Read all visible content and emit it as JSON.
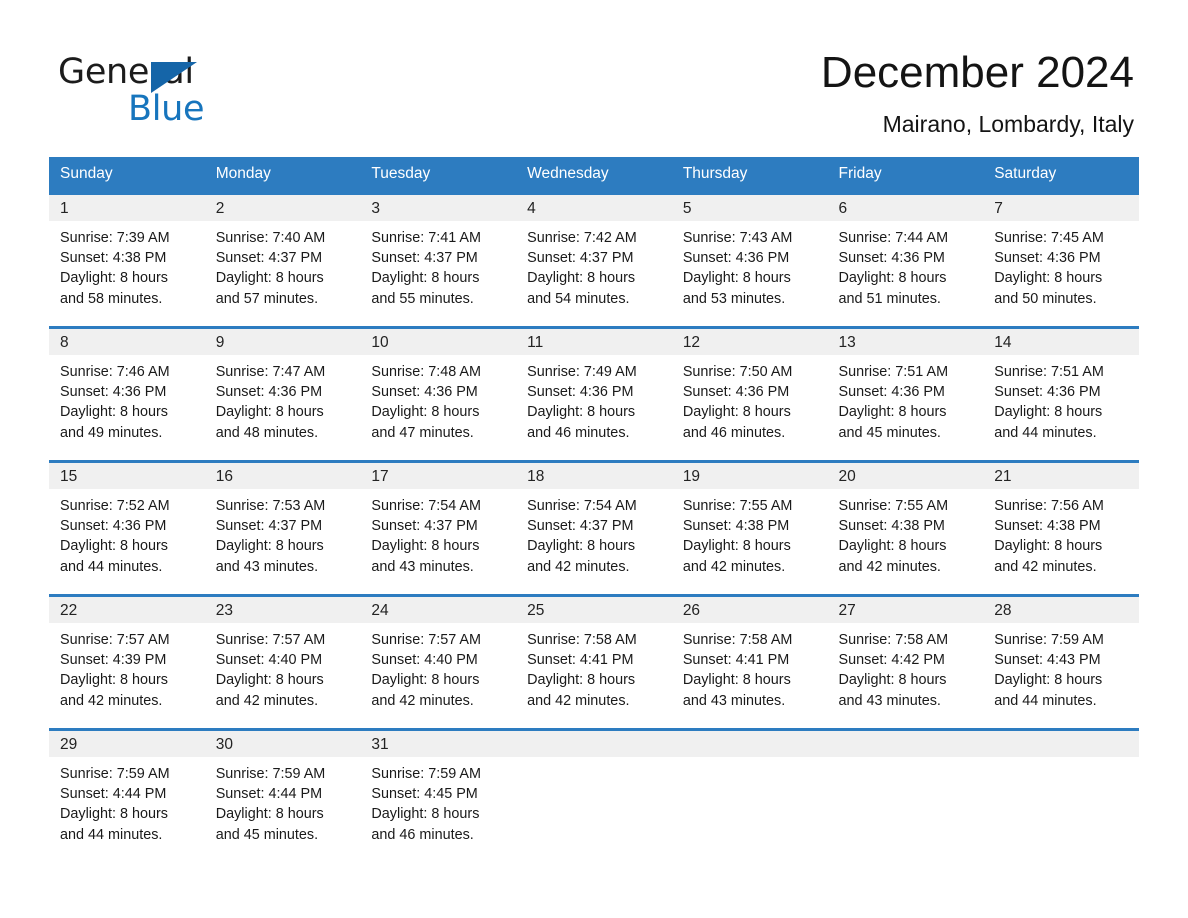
{
  "brand": {
    "word_one": "General",
    "word_two": "Blue",
    "triangle_color": "#1565a8",
    "blue_color": "#1775bd"
  },
  "header": {
    "title": "December 2024",
    "location": "Mairano, Lombardy, Italy"
  },
  "theme": {
    "header_row_bg": "#2d7cc0",
    "row_rule": "#2d7cc0",
    "daynum_band_bg": "#f0f0f0",
    "page_bg": "#ffffff",
    "text": "#1a1a1a"
  },
  "weekday_headers": [
    "Sunday",
    "Monday",
    "Tuesday",
    "Wednesday",
    "Thursday",
    "Friday",
    "Saturday"
  ],
  "weeks": [
    [
      {
        "day": "1",
        "sunrise": "Sunrise: 7:39 AM",
        "sunset": "Sunset: 4:38 PM",
        "daylight_1": "Daylight: 8 hours",
        "daylight_2": "and 58 minutes."
      },
      {
        "day": "2",
        "sunrise": "Sunrise: 7:40 AM",
        "sunset": "Sunset: 4:37 PM",
        "daylight_1": "Daylight: 8 hours",
        "daylight_2": "and 57 minutes."
      },
      {
        "day": "3",
        "sunrise": "Sunrise: 7:41 AM",
        "sunset": "Sunset: 4:37 PM",
        "daylight_1": "Daylight: 8 hours",
        "daylight_2": "and 55 minutes."
      },
      {
        "day": "4",
        "sunrise": "Sunrise: 7:42 AM",
        "sunset": "Sunset: 4:37 PM",
        "daylight_1": "Daylight: 8 hours",
        "daylight_2": "and 54 minutes."
      },
      {
        "day": "5",
        "sunrise": "Sunrise: 7:43 AM",
        "sunset": "Sunset: 4:36 PM",
        "daylight_1": "Daylight: 8 hours",
        "daylight_2": "and 53 minutes."
      },
      {
        "day": "6",
        "sunrise": "Sunrise: 7:44 AM",
        "sunset": "Sunset: 4:36 PM",
        "daylight_1": "Daylight: 8 hours",
        "daylight_2": "and 51 minutes."
      },
      {
        "day": "7",
        "sunrise": "Sunrise: 7:45 AM",
        "sunset": "Sunset: 4:36 PM",
        "daylight_1": "Daylight: 8 hours",
        "daylight_2": "and 50 minutes."
      }
    ],
    [
      {
        "day": "8",
        "sunrise": "Sunrise: 7:46 AM",
        "sunset": "Sunset: 4:36 PM",
        "daylight_1": "Daylight: 8 hours",
        "daylight_2": "and 49 minutes."
      },
      {
        "day": "9",
        "sunrise": "Sunrise: 7:47 AM",
        "sunset": "Sunset: 4:36 PM",
        "daylight_1": "Daylight: 8 hours",
        "daylight_2": "and 48 minutes."
      },
      {
        "day": "10",
        "sunrise": "Sunrise: 7:48 AM",
        "sunset": "Sunset: 4:36 PM",
        "daylight_1": "Daylight: 8 hours",
        "daylight_2": "and 47 minutes."
      },
      {
        "day": "11",
        "sunrise": "Sunrise: 7:49 AM",
        "sunset": "Sunset: 4:36 PM",
        "daylight_1": "Daylight: 8 hours",
        "daylight_2": "and 46 minutes."
      },
      {
        "day": "12",
        "sunrise": "Sunrise: 7:50 AM",
        "sunset": "Sunset: 4:36 PM",
        "daylight_1": "Daylight: 8 hours",
        "daylight_2": "and 46 minutes."
      },
      {
        "day": "13",
        "sunrise": "Sunrise: 7:51 AM",
        "sunset": "Sunset: 4:36 PM",
        "daylight_1": "Daylight: 8 hours",
        "daylight_2": "and 45 minutes."
      },
      {
        "day": "14",
        "sunrise": "Sunrise: 7:51 AM",
        "sunset": "Sunset: 4:36 PM",
        "daylight_1": "Daylight: 8 hours",
        "daylight_2": "and 44 minutes."
      }
    ],
    [
      {
        "day": "15",
        "sunrise": "Sunrise: 7:52 AM",
        "sunset": "Sunset: 4:36 PM",
        "daylight_1": "Daylight: 8 hours",
        "daylight_2": "and 44 minutes."
      },
      {
        "day": "16",
        "sunrise": "Sunrise: 7:53 AM",
        "sunset": "Sunset: 4:37 PM",
        "daylight_1": "Daylight: 8 hours",
        "daylight_2": "and 43 minutes."
      },
      {
        "day": "17",
        "sunrise": "Sunrise: 7:54 AM",
        "sunset": "Sunset: 4:37 PM",
        "daylight_1": "Daylight: 8 hours",
        "daylight_2": "and 43 minutes."
      },
      {
        "day": "18",
        "sunrise": "Sunrise: 7:54 AM",
        "sunset": "Sunset: 4:37 PM",
        "daylight_1": "Daylight: 8 hours",
        "daylight_2": "and 42 minutes."
      },
      {
        "day": "19",
        "sunrise": "Sunrise: 7:55 AM",
        "sunset": "Sunset: 4:38 PM",
        "daylight_1": "Daylight: 8 hours",
        "daylight_2": "and 42 minutes."
      },
      {
        "day": "20",
        "sunrise": "Sunrise: 7:55 AM",
        "sunset": "Sunset: 4:38 PM",
        "daylight_1": "Daylight: 8 hours",
        "daylight_2": "and 42 minutes."
      },
      {
        "day": "21",
        "sunrise": "Sunrise: 7:56 AM",
        "sunset": "Sunset: 4:38 PM",
        "daylight_1": "Daylight: 8 hours",
        "daylight_2": "and 42 minutes."
      }
    ],
    [
      {
        "day": "22",
        "sunrise": "Sunrise: 7:57 AM",
        "sunset": "Sunset: 4:39 PM",
        "daylight_1": "Daylight: 8 hours",
        "daylight_2": "and 42 minutes."
      },
      {
        "day": "23",
        "sunrise": "Sunrise: 7:57 AM",
        "sunset": "Sunset: 4:40 PM",
        "daylight_1": "Daylight: 8 hours",
        "daylight_2": "and 42 minutes."
      },
      {
        "day": "24",
        "sunrise": "Sunrise: 7:57 AM",
        "sunset": "Sunset: 4:40 PM",
        "daylight_1": "Daylight: 8 hours",
        "daylight_2": "and 42 minutes."
      },
      {
        "day": "25",
        "sunrise": "Sunrise: 7:58 AM",
        "sunset": "Sunset: 4:41 PM",
        "daylight_1": "Daylight: 8 hours",
        "daylight_2": "and 42 minutes."
      },
      {
        "day": "26",
        "sunrise": "Sunrise: 7:58 AM",
        "sunset": "Sunset: 4:41 PM",
        "daylight_1": "Daylight: 8 hours",
        "daylight_2": "and 43 minutes."
      },
      {
        "day": "27",
        "sunrise": "Sunrise: 7:58 AM",
        "sunset": "Sunset: 4:42 PM",
        "daylight_1": "Daylight: 8 hours",
        "daylight_2": "and 43 minutes."
      },
      {
        "day": "28",
        "sunrise": "Sunrise: 7:59 AM",
        "sunset": "Sunset: 4:43 PM",
        "daylight_1": "Daylight: 8 hours",
        "daylight_2": "and 44 minutes."
      }
    ],
    [
      {
        "day": "29",
        "sunrise": "Sunrise: 7:59 AM",
        "sunset": "Sunset: 4:44 PM",
        "daylight_1": "Daylight: 8 hours",
        "daylight_2": "and 44 minutes."
      },
      {
        "day": "30",
        "sunrise": "Sunrise: 7:59 AM",
        "sunset": "Sunset: 4:44 PM",
        "daylight_1": "Daylight: 8 hours",
        "daylight_2": "and 45 minutes."
      },
      {
        "day": "31",
        "sunrise": "Sunrise: 7:59 AM",
        "sunset": "Sunset: 4:45 PM",
        "daylight_1": "Daylight: 8 hours",
        "daylight_2": "and 46 minutes."
      },
      {
        "day": "",
        "sunrise": "",
        "sunset": "",
        "daylight_1": "",
        "daylight_2": ""
      },
      {
        "day": "",
        "sunrise": "",
        "sunset": "",
        "daylight_1": "",
        "daylight_2": ""
      },
      {
        "day": "",
        "sunrise": "",
        "sunset": "",
        "daylight_1": "",
        "daylight_2": ""
      },
      {
        "day": "",
        "sunrise": "",
        "sunset": "",
        "daylight_1": "",
        "daylight_2": ""
      }
    ]
  ]
}
